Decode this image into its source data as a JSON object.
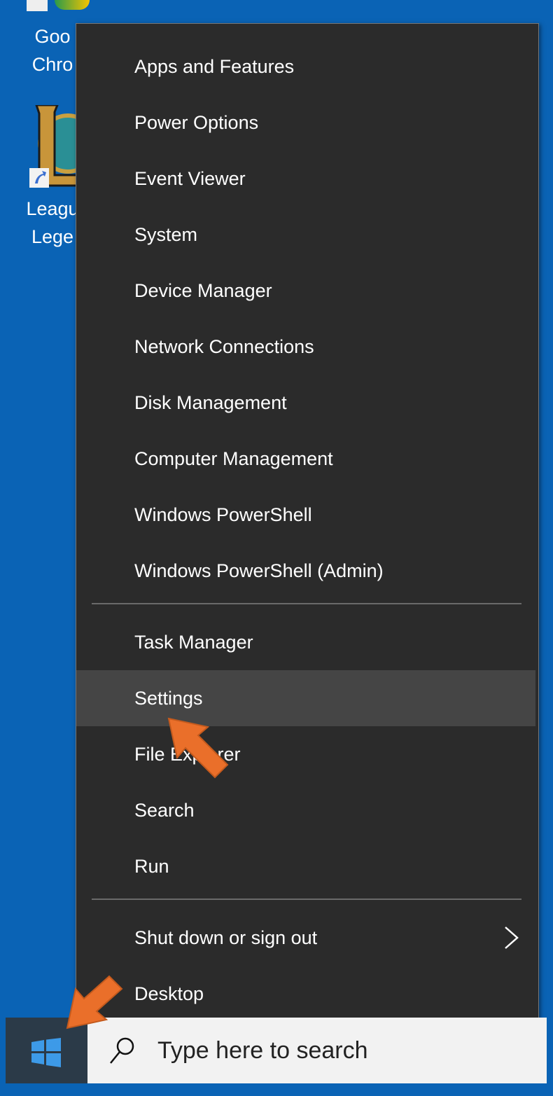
{
  "desktop": {
    "icons": [
      {
        "label_line1": "Goo",
        "label_line2": "Chro"
      },
      {
        "label_line1": "Leagu",
        "label_line2": "Lege"
      }
    ]
  },
  "context_menu": {
    "items": [
      {
        "label": "Apps and Features"
      },
      {
        "label": "Power Options"
      },
      {
        "label": "Event Viewer"
      },
      {
        "label": "System"
      },
      {
        "label": "Device Manager"
      },
      {
        "label": "Network Connections"
      },
      {
        "label": "Disk Management"
      },
      {
        "label": "Computer Management"
      },
      {
        "label": "Windows PowerShell"
      },
      {
        "label": "Windows PowerShell (Admin)"
      },
      {
        "label": "Task Manager"
      },
      {
        "label": "Settings",
        "highlighted": true
      },
      {
        "label": "File Explorer"
      },
      {
        "label": "Search"
      },
      {
        "label": "Run"
      },
      {
        "label": "Shut down or sign out",
        "has_submenu": true
      },
      {
        "label": "Desktop"
      }
    ]
  },
  "taskbar": {
    "search_placeholder": "Type here to search"
  },
  "colors": {
    "desktop_bg": "#0a63b5",
    "menu_bg": "#2b2b2b",
    "highlight_bg": "#454545",
    "arrow": "#ea6f2a",
    "start_icon": "#3d9ae8"
  }
}
